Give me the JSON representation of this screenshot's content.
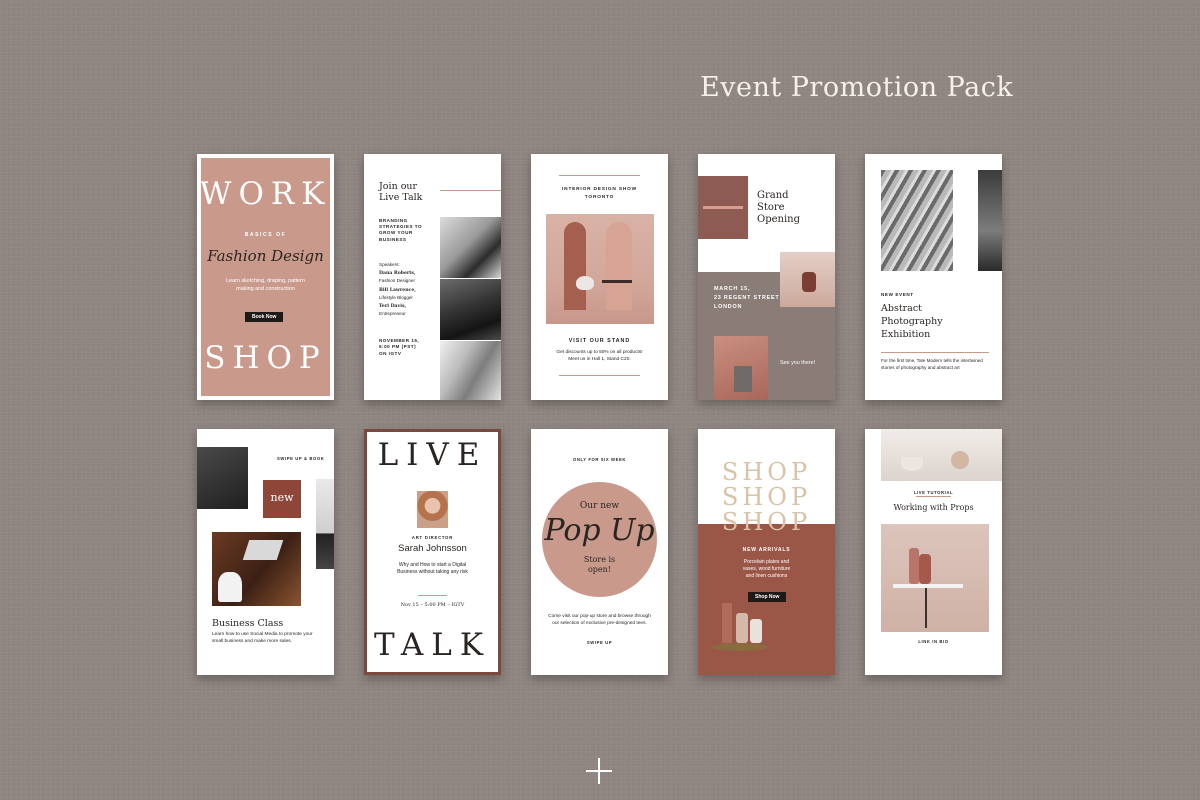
{
  "header": {
    "title": "Event Promotion Pack"
  },
  "colors": {
    "background": "#8f8581",
    "rose": "#c99a8c",
    "terracotta": "#9a5647",
    "taupe": "#8a7c77"
  },
  "cards": {
    "workshop": {
      "word_top": "WORK",
      "word_bottom": "SHOP",
      "kicker": "BASICS OF",
      "script": "Fashion Design",
      "body": "Learn sketching, draping, pattern making and construction",
      "button": "Book Now"
    },
    "live_talk_list": {
      "title": "Join our Live Talk",
      "subtitle": "BRANDING STRATEGIES TO GROW YOUR BUSINESS",
      "speakers_label": "Speakers:",
      "speakers": [
        {
          "name": "Dana Roberts,",
          "role": "Fashion Designer"
        },
        {
          "name": "Bill Lawrence,",
          "role": "Lifestyle Blogger"
        },
        {
          "name": "Teri Davis,",
          "role": "Entrepreneur"
        }
      ],
      "date": "NOVEMBER 15, 5:00 PM (PST) ON IGTV"
    },
    "interior": {
      "title": "INTERIOR DESIGN SHOW",
      "city": "TORONTO",
      "cta": "VISIT OUR STAND",
      "body": "Get discounts up to 50% on all products! Meet us in Hall 1, Stand C20."
    },
    "grand_opening": {
      "title": "Grand Store Opening",
      "date": "MARCH 15,",
      "address": "23 REGENT STREET",
      "city": "LONDON",
      "note": "See you there!"
    },
    "exhibition": {
      "kicker": "NEW EVENT",
      "title": "Abstract Photography Exhibition",
      "body": "For the first time, Tate Modern tells the intertwined stories of photography and abstract art"
    },
    "business_class": {
      "swipe": "SWIPE UP & BOOK",
      "badge": "new",
      "title": "Business Class",
      "body": "Learn how to use Social Media to promote your small business and make more sales."
    },
    "live_talk_portrait": {
      "word_top": "LIVE",
      "word_bottom": "TALK",
      "role": "ART DIRECTOR",
      "name": "Sarah Johnsson",
      "body": "Why and How to start a Digital Business without taking any risk",
      "date": "Nov 15 – 5:00 PM – IGTV"
    },
    "popup": {
      "kicker": "ONLY FOR SIX WEEK",
      "line1": "Our new",
      "script": "Pop Up",
      "line2": "Store is open!",
      "body": "Come visit our pop-up store and browse through our selection of exclusive pre-designed tees.",
      "swipe": "SWIPE UP"
    },
    "shop_arrivals": {
      "words": [
        "SHOP",
        "SHOP",
        "SHOP"
      ],
      "kicker": "NEW ARRIVALS",
      "body": "Porcelain plates and vases, wood furniture and linen cushions",
      "button": "Shop Now"
    },
    "props": {
      "kicker": "LIVE TUTORIAL",
      "title": "Working with Props",
      "footer": "LINK IN BIO"
    }
  }
}
